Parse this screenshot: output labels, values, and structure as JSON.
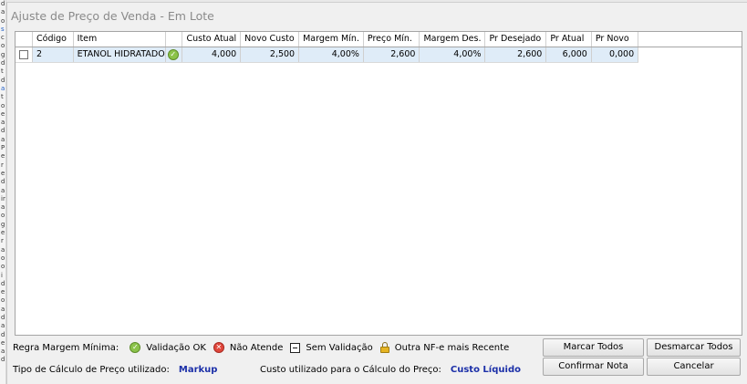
{
  "window": {
    "title": "Ajuste de Preço de Venda - Em Lote"
  },
  "grid": {
    "columns": [
      "",
      "Código",
      "Item",
      "",
      "Custo Atual",
      "Novo Custo",
      "Margem Mín.",
      "Preço Mín.",
      "Margem Des.",
      "Pr Desejado",
      "Pr Atual",
      "Pr Novo",
      ""
    ],
    "rows": [
      {
        "checked": false,
        "codigo": "2",
        "item": "ETANOL HIDRATADO",
        "status_icon": "check-circle-icon",
        "custo_atual": "4,000",
        "novo_custo": "2,500",
        "margem_min": "4,00%",
        "preco_min": "2,600",
        "margem_des": "4,00%",
        "pr_desejado": "2,600",
        "pr_atual": "6,000",
        "pr_novo": "0,000"
      }
    ]
  },
  "legend": {
    "label": "Regra Margem Mínima:",
    "items": [
      {
        "icon": "check-circle-icon",
        "text": "Validação OK"
      },
      {
        "icon": "x-circle-icon",
        "text": "Não Atende"
      },
      {
        "icon": "minus-square-icon",
        "text": "Sem Validação"
      },
      {
        "icon": "lock-icon",
        "text": "Outra NF-e mais Recente"
      }
    ]
  },
  "calc": {
    "label": "Tipo de Cálculo de Preço utilizado:",
    "value": "Markup"
  },
  "custo": {
    "label": "Custo utilizado para o Cálculo do Preço:",
    "value": "Custo Líquido"
  },
  "buttons": {
    "marcar_todos": "Marcar Todos",
    "desmarcar_todos": "Desmarcar Todos",
    "confirmar_nota": "Confirmar Nota",
    "cancelar": "Cancelar"
  },
  "colors": {
    "selected_row": "#dfecf8",
    "value_text": "#1b2fa8",
    "ok_green": "#8bc34a",
    "error_red": "#e0463b"
  }
}
